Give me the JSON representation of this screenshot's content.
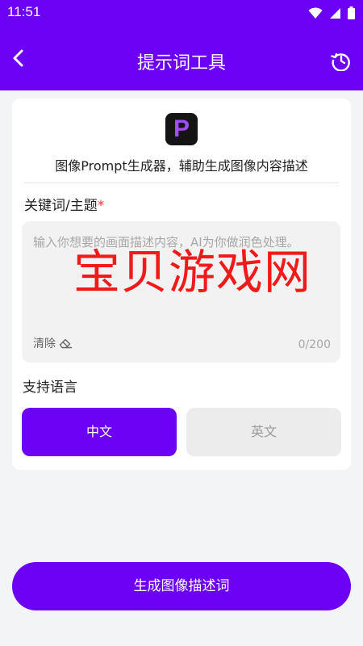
{
  "status_bar": {
    "time": "11:51",
    "icons": [
      "wifi-icon",
      "signal-icon",
      "battery-icon"
    ]
  },
  "app_bar": {
    "title": "提示词工具",
    "back_icon": "back-arrow-icon",
    "history_icon": "history-icon"
  },
  "card": {
    "logo_letter": "P",
    "subtitle": "图像Prompt生成器，辅助生成图像内容描述",
    "keyword_label": "关键词/主题",
    "required_mark": "*",
    "input": {
      "placeholder": "输入你想要的画面描述内容，AI为你做润色处理。",
      "value": ""
    },
    "clear_label": "清除",
    "counter": "0/200",
    "language_label": "支持语言",
    "languages": [
      {
        "label": "中文",
        "selected": true
      },
      {
        "label": "英文",
        "selected": false
      }
    ]
  },
  "watermark": "宝贝游戏网",
  "generate_button": "生成图像描述词",
  "colors": {
    "primary": "#6c00f5",
    "required": "#e53935",
    "watermark": "#f01a1a"
  }
}
